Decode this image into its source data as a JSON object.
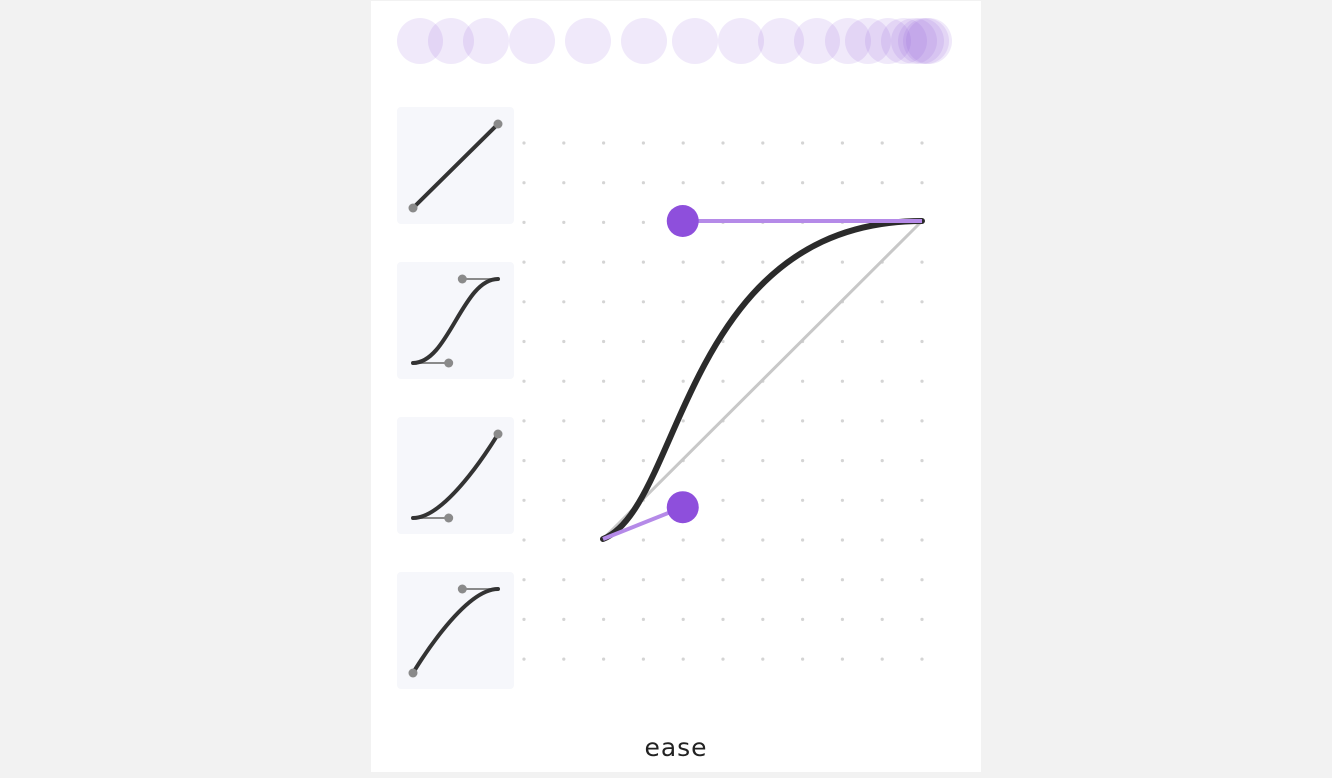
{
  "curve": {
    "name": "ease",
    "p1": [
      0.25,
      0.1
    ],
    "p2": [
      0.25,
      1.0
    ]
  },
  "presets": [
    {
      "id": "linear",
      "p1": [
        0.0,
        0.0
      ],
      "p2": [
        1.0,
        1.0
      ]
    },
    {
      "id": "ease-in-out",
      "p1": [
        0.42,
        0.0
      ],
      "p2": [
        0.58,
        1.0
      ]
    },
    {
      "id": "ease-in",
      "p1": [
        0.42,
        0.0
      ],
      "p2": [
        1.0,
        1.0
      ]
    },
    {
      "id": "ease-out",
      "p1": [
        0.0,
        0.0
      ],
      "p2": [
        0.58,
        1.0
      ]
    }
  ],
  "trail_progress": [
    0.0,
    0.06,
    0.13,
    0.22,
    0.33,
    0.44,
    0.54,
    0.63,
    0.71,
    0.78,
    0.84,
    0.88,
    0.92,
    0.95,
    0.97,
    0.985,
    0.995,
    1.0
  ],
  "colors": {
    "accent": "#8e4fdc",
    "accent_light": "#b58ae8",
    "curve": "#2b2b2b",
    "diagonal": "#c8c8c8",
    "grid_dot": "#d4d4d4",
    "preset_line": "#333333",
    "preset_point": "#8a8a8a"
  }
}
